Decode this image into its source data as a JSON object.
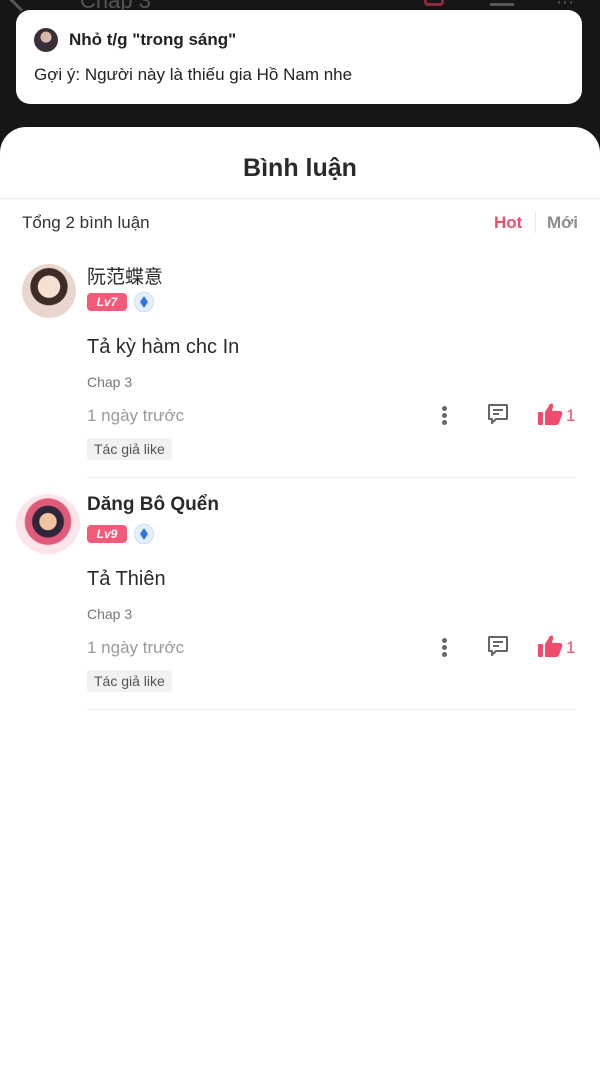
{
  "background": {
    "title": "Chap 3"
  },
  "toast": {
    "title": "Nhỏ t/g \"trong sáng\"",
    "body": "Gợi ý: Người này là thiếu gia Hồ Nam nhe"
  },
  "sheet": {
    "title": "Bình luận",
    "total": "Tổng 2 bình luận",
    "sort_hot": "Hot",
    "sort_new": "Mới"
  },
  "comments": [
    {
      "username": "阮范蝶意",
      "level": "Lv7",
      "text": "Tả kỳ hàm chc In",
      "chapter": "Chap 3",
      "time": "1 ngày trước",
      "likes": "1",
      "badge": "Tác giả like"
    },
    {
      "username": "Dăng Bô Quển",
      "level": "Lv9",
      "text": "Tả Thiên",
      "chapter": "Chap 3",
      "time": "1 ngày trước",
      "likes": "1",
      "badge": "Tác giả like"
    }
  ],
  "colors": {
    "accent": "#f04d6a",
    "level_badge": "#f35b78",
    "gem": "#2f73e0"
  },
  "icons": [
    "back-icon",
    "gift-icon",
    "list-icon",
    "more-vertical-icon",
    "reply-icon",
    "thumbs-up-icon",
    "diamond-icon"
  ]
}
